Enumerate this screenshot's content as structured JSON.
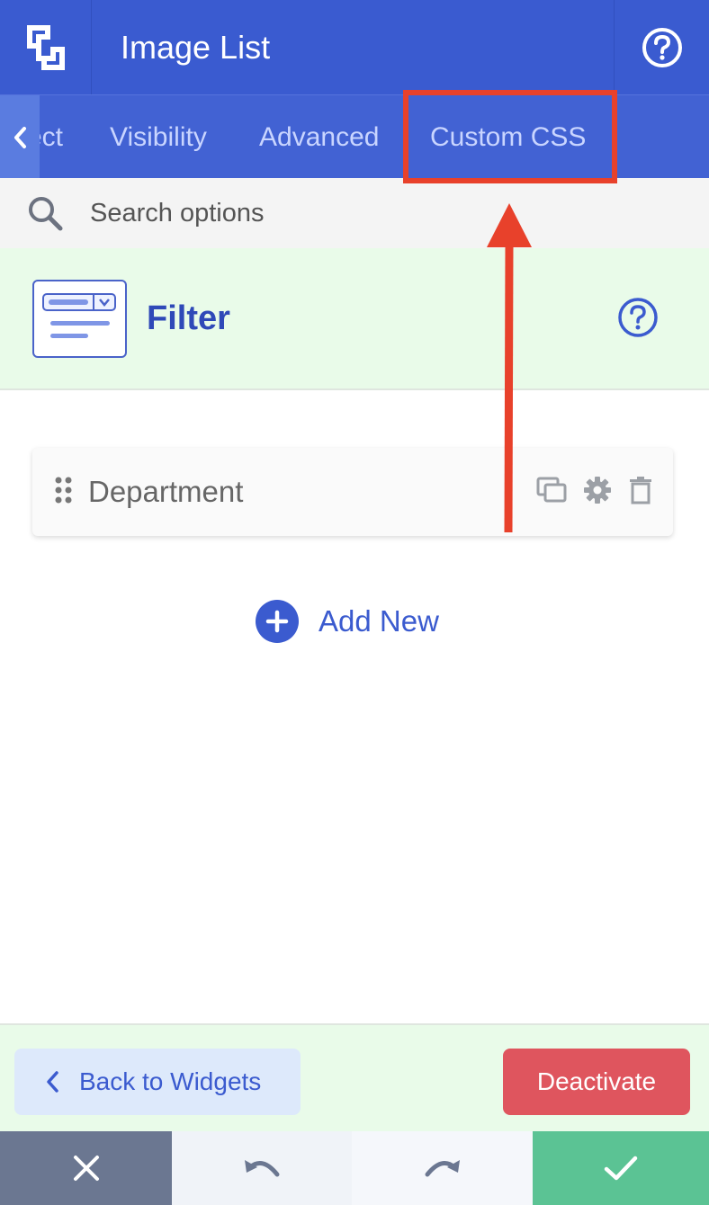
{
  "header": {
    "title": "Image List",
    "logo_icon": "logo-icon",
    "help_icon": "help-circle-icon"
  },
  "tabs": [
    {
      "label": "ect"
    },
    {
      "label": "Visibility"
    },
    {
      "label": "Advanced"
    },
    {
      "label": "Custom CSS"
    }
  ],
  "search": {
    "placeholder": "Search options"
  },
  "filter": {
    "title": "Filter"
  },
  "items": [
    {
      "label": "Department"
    }
  ],
  "add_new": {
    "label": "Add New"
  },
  "footer": {
    "back_label": "Back to Widgets",
    "deactivate_label": "Deactivate"
  },
  "colors": {
    "header_bg": "#3a5bd0",
    "accent": "#3b5bcf",
    "section_bg": "#e9fbe9",
    "danger": "#df555e",
    "success": "#5bc394",
    "annotation": "#e8412b"
  }
}
